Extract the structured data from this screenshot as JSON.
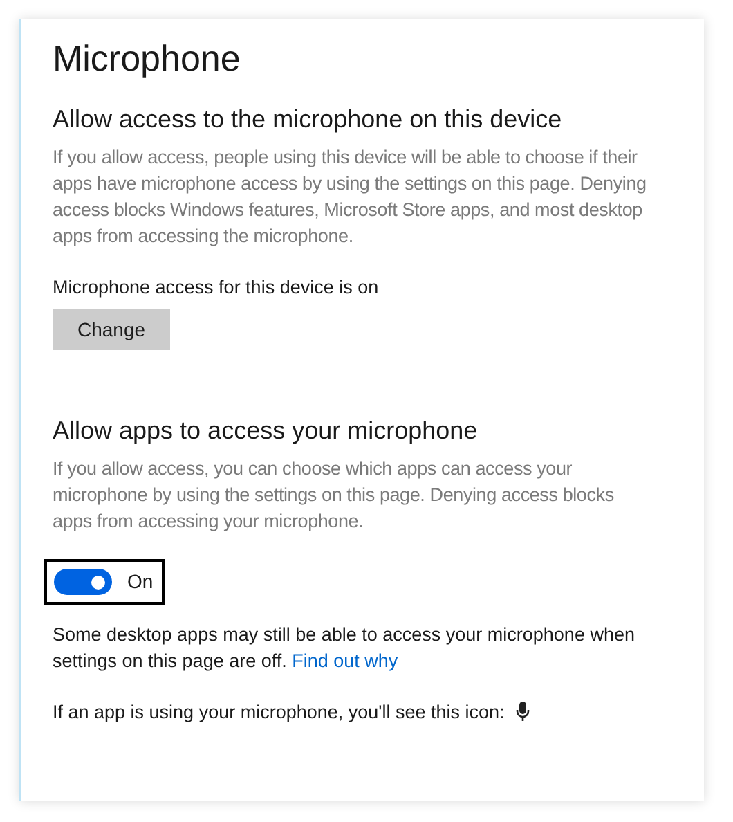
{
  "page": {
    "title": "Microphone"
  },
  "device_section": {
    "heading": "Allow access to the microphone on this device",
    "description": "If you allow access, people using this device will be able to choose if their apps have microphone access by using the settings on this page. Denying access blocks Windows features, Microsoft Store apps, and most desktop apps from accessing the microphone.",
    "status": "Microphone access for this device is on",
    "button": "Change"
  },
  "apps_section": {
    "heading": "Allow apps to access your microphone",
    "description": "If you allow access, you can choose which apps can access your microphone by using the settings on this page. Denying access blocks apps from accessing your microphone.",
    "toggle": {
      "on": true,
      "focused": true,
      "label": "On"
    }
  },
  "note": {
    "text": "Some desktop apps may still be able to access your microphone when settings on this page are off.",
    "link": "Find out why"
  },
  "icon_note": "If an app is using your microphone, you'll see this icon:"
}
